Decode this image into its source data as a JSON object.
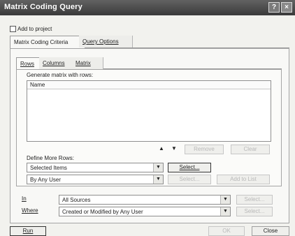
{
  "window": {
    "title": "Matrix Coding Query",
    "help_glyph": "?",
    "close_glyph": "×"
  },
  "add_to_project": {
    "label": "Add to project",
    "checked": false
  },
  "outer_tabs": [
    {
      "label": "Matrix Coding Criteria"
    },
    {
      "label": "Query Options"
    }
  ],
  "inner_tabs": [
    {
      "label": "Rows"
    },
    {
      "label": "Columns"
    },
    {
      "label": "Matrix"
    }
  ],
  "rows_panel": {
    "group_label": "Generate matrix with rows:",
    "list_header": "Name",
    "up_glyph": "▲",
    "down_glyph": "▼",
    "remove_label": "Remove",
    "clear_label": "Clear",
    "define_more_label": "Define More Rows:",
    "selected_items": {
      "value": "Selected Items"
    },
    "select_label": "Select...",
    "by_any_user": {
      "value": "By Any User"
    },
    "select2_label": "Select...",
    "add_to_list_label": "Add to List"
  },
  "in_row": {
    "label": "In",
    "value": "All Sources",
    "select_label": "Select..."
  },
  "where_row": {
    "label": "Where",
    "value": "Created or Modified by Any User",
    "select_label": "Select..."
  },
  "footer": {
    "run_label": "Run",
    "ok_label": "OK",
    "close_label": "Close"
  },
  "dropdown_glyph": "▼"
}
